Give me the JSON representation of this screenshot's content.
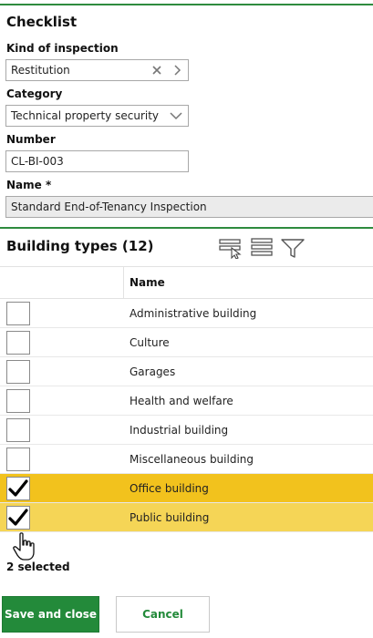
{
  "checklist": {
    "title": "Checklist",
    "kind_label": "Kind of inspection",
    "kind_value": "Restitution",
    "category_label": "Category",
    "category_value": "Technical property security",
    "number_label": "Number",
    "number_value": "CL-BI-003",
    "name_label": "Name *",
    "name_value": "Standard End-of-Tenancy Inspection"
  },
  "building_types": {
    "title": "Building types (12)",
    "column_name": "Name",
    "rows": [
      {
        "name": "Administrative building",
        "checked": false
      },
      {
        "name": "Culture",
        "checked": false
      },
      {
        "name": "Garages",
        "checked": false
      },
      {
        "name": "Health and welfare",
        "checked": false
      },
      {
        "name": "Industrial building",
        "checked": false
      },
      {
        "name": "Miscellaneous building",
        "checked": false
      },
      {
        "name": "Office building",
        "checked": true
      },
      {
        "name": "Public building",
        "checked": true
      }
    ],
    "selected_text": "2 selected"
  },
  "actions": {
    "save_label": "Save and close",
    "cancel_label": "Cancel"
  },
  "colors": {
    "accent_green": "#238a3a",
    "selected_row_primary": "#f2c21d",
    "selected_row_secondary": "#f5d556"
  }
}
